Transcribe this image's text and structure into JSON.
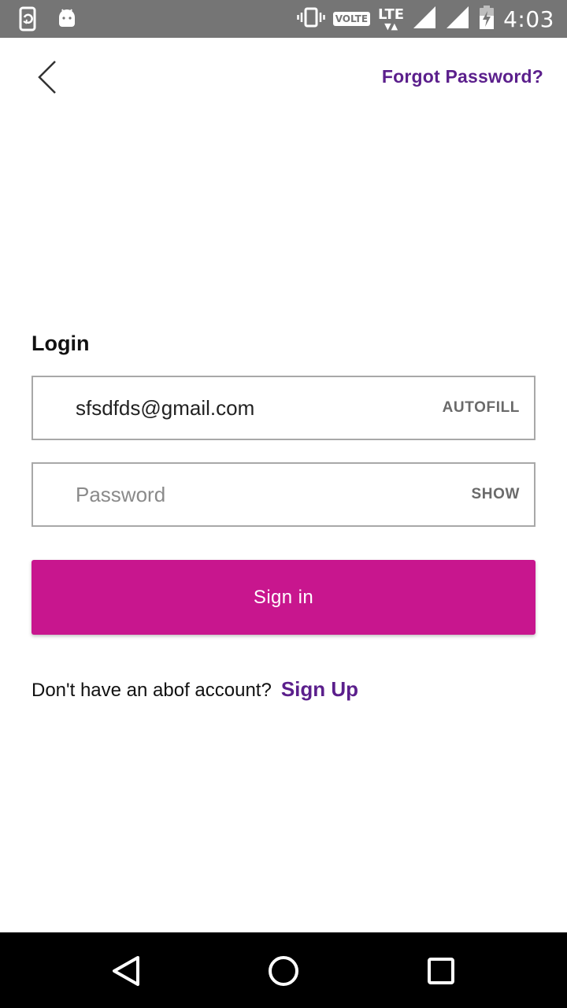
{
  "status_bar": {
    "time": "4:03",
    "volte": "VOLTE",
    "lte": "LTE",
    "icons": [
      "screen-rotate-icon",
      "android-debug-icon",
      "vibrate-icon",
      "signal-icon",
      "signal-icon",
      "battery-charging-icon"
    ]
  },
  "header": {
    "forgot_password": "Forgot Password?"
  },
  "login": {
    "title": "Login",
    "email_value": "sfsdfds@gmail.com",
    "email_action": "AUTOFILL",
    "password_placeholder": "Password",
    "password_action": "SHOW",
    "signin_label": "Sign in"
  },
  "signup": {
    "prompt": "Don't have an abof account?",
    "link": "Sign Up"
  },
  "colors": {
    "accent_purple": "#5b1f8c",
    "button_magenta": "#c8168e",
    "status_bar": "#757575"
  }
}
